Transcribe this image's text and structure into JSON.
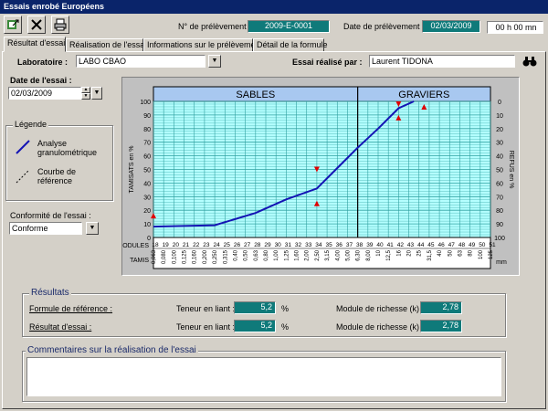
{
  "window": {
    "title": "Essais enrobé Européens"
  },
  "toolbar": {
    "icons": [
      "export-icon",
      "close-icon",
      "print-icon"
    ]
  },
  "header": {
    "sample_no_label": "N° de prélèvement :",
    "sample_no_value": "2009-E-0001",
    "sample_date_label": "Date de prélèvement :",
    "sample_date_value": "02/03/2009",
    "time_value": "00 h 00 mn"
  },
  "tabs": [
    {
      "label": "Résultat d'essai",
      "active": true
    },
    {
      "label": "Réalisation de l'essai",
      "active": false
    },
    {
      "label": "Informations sur le prélèvement",
      "active": false
    },
    {
      "label": "Détail de la formule",
      "active": false
    }
  ],
  "form": {
    "laboratory_label": "Laboratoire :",
    "laboratory_value": "LABO CBAO",
    "tester_label": "Essai réalisé par :",
    "tester_value": "Laurent TIDONA",
    "test_date_label": "Date de l'essai :",
    "test_date_value": "02/03/2009",
    "conformity_label": "Conformité de l'essai :",
    "conformity_value": "Conforme"
  },
  "legend": {
    "title": "Légende",
    "item1": "Analyse",
    "item1b": "granulométrique",
    "item2": "Courbe de",
    "item2b": "référence"
  },
  "results": {
    "title": "Résultats",
    "row1_label": "Formule de référence :",
    "row2_label": "Résultat d'essai :",
    "binder_label": "Teneur en liant :",
    "binder_unit": "%",
    "richness_label": "Module de richesse (k) :",
    "row1_binder": "5,2",
    "row1_richness": "2,78",
    "row2_binder": "5,2",
    "row2_richness": "2,78"
  },
  "comments": {
    "title": "Commentaires sur la réalisation de l'essai",
    "value": ""
  },
  "chart_data": {
    "type": "line",
    "sections": [
      "SABLES",
      "GRAVIERS"
    ],
    "ylabel": "TAMISATS en %",
    "ylabel_right": "REFUS en %",
    "ylim": [
      0,
      100
    ],
    "yticks": [
      0,
      10,
      20,
      30,
      40,
      50,
      60,
      70,
      80,
      90,
      100
    ],
    "yticks_right": [
      100,
      90,
      80,
      70,
      60,
      50,
      40,
      30,
      20,
      10,
      0
    ],
    "modules_label": "MODULES",
    "tamis_label": "TAMIS",
    "x_unit": "mm",
    "modules": [
      "18",
      "19",
      "20",
      "21",
      "22",
      "23",
      "24",
      "25",
      "26",
      "27",
      "28",
      "29",
      "30",
      "31",
      "32",
      "33",
      "34",
      "35",
      "36",
      "37",
      "38",
      "39",
      "40",
      "41",
      "42",
      "43",
      "44",
      "45",
      "46",
      "47",
      "48",
      "49",
      "50",
      "51"
    ],
    "tamis": [
      "0,063",
      "0,080",
      "0,100",
      "0,125",
      "0,160",
      "0,200",
      "0,250",
      "0,315",
      "0,40",
      "0,50",
      "0,63",
      "0,80",
      "1,00",
      "1,25",
      "1,60",
      "2,00",
      "2,50",
      "3,15",
      "4,00",
      "5,00",
      "6,30",
      "8,00",
      "10",
      "12,5",
      "16",
      "20",
      "25",
      "31,5",
      "40",
      "50",
      "63",
      "80",
      "100",
      "125"
    ],
    "series": [
      {
        "name": "Analyse granulométrique",
        "x_modules": [
          18,
          24,
          28,
          31,
          34,
          36,
          38,
          40,
          42,
          43.5
        ],
        "y": [
          8,
          9,
          18,
          28,
          36,
          51,
          66,
          80,
          95,
          100
        ]
      }
    ],
    "limit_markers": {
      "up": [
        18,
        34,
        42,
        43.5
      ],
      "down": [
        34,
        42
      ]
    },
    "grid": true
  }
}
